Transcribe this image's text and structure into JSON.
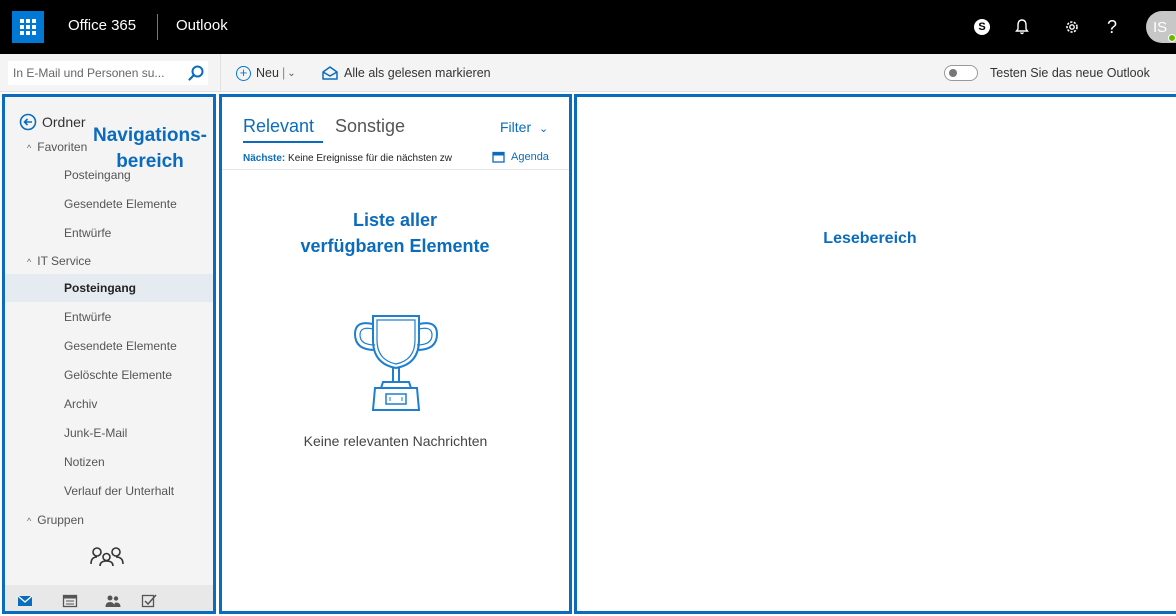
{
  "topbar": {
    "brand": "Office 365",
    "app": "Outlook",
    "icons": [
      "skype-icon",
      "bell-icon",
      "gear-icon",
      "help-icon"
    ],
    "help_glyph": "?",
    "skype_glyph": "S",
    "avatar_initials": "IS"
  },
  "commandbar": {
    "search_placeholder": "In E-Mail und Personen su...",
    "new_label": "Neu",
    "new_divider": "|",
    "mark_all_read_label": "Alle als gelesen markieren",
    "try_new_outlook_label": "Testen Sie das neue Outlook"
  },
  "nav": {
    "header": "Ordner",
    "favorites_label": "Favoriten",
    "favorites": [
      "Posteingang",
      "Gesendete Elemente",
      "Entwürfe"
    ],
    "account_label": "IT Service",
    "account_items": [
      "Posteingang",
      "Entwürfe",
      "Gesendete Elemente",
      "Gelöschte Elemente",
      "Archiv",
      "Junk-E-Mail",
      "Notizen",
      "Verlauf der Unterhalt"
    ],
    "active_item": "Posteingang",
    "groups_label": "Gruppen",
    "footer_icons": [
      "mail-icon",
      "calendar-icon",
      "people-icon",
      "tasks-icon"
    ]
  },
  "list": {
    "tab_relevant": "Relevant",
    "tab_other": "Sonstige",
    "filter_label": "Filter",
    "next_label": "Nächste:",
    "next_text": "Keine Ereignisse für die nächsten zw",
    "agenda_label": "Agenda",
    "empty_message": "Keine relevanten Nachrichten"
  },
  "annotations": {
    "nav_line1": "Navigations-",
    "nav_line2": "bereich",
    "list_line1": "Liste aller",
    "list_line2": "verfügbaren Elemente",
    "reading": "Lesebereich"
  },
  "colors": {
    "accent": "#0b6cbd",
    "topbar_bg": "#000000",
    "waffle_bg": "#0078d4"
  }
}
